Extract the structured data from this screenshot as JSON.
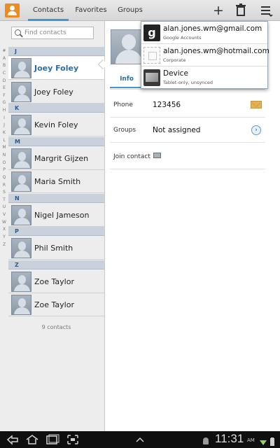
{
  "actionbar": {
    "tabs": [
      {
        "label": "Contacts",
        "active": true
      },
      {
        "label": "Favorites",
        "active": false
      },
      {
        "label": "Groups",
        "active": false
      }
    ],
    "add_icon": "plus-icon",
    "delete_icon": "trash-icon",
    "menu_icon": "overflow-menu-icon"
  },
  "search": {
    "placeholder": "Find contacts"
  },
  "index_letters": [
    "#",
    "A",
    "B",
    "C",
    "D",
    "E",
    "F",
    "G",
    "H",
    "I",
    "J",
    "K",
    "L",
    "M",
    "N",
    "O",
    "P",
    "Q",
    "R",
    "S",
    "T",
    "U",
    "V",
    "W",
    "X",
    "Y",
    "Z"
  ],
  "contacts": [
    {
      "section": "J",
      "entries": [
        "Joey Foley",
        "Joey Foley"
      ]
    },
    {
      "section": "K",
      "entries": [
        "Kevin Foley"
      ]
    },
    {
      "section": "M",
      "entries": [
        "Margrit Gijzen",
        "Maria Smith"
      ]
    },
    {
      "section": "N",
      "entries": [
        "Nigel Jameson"
      ]
    },
    {
      "section": "P",
      "entries": [
        "Phil Smith"
      ]
    },
    {
      "section": "Z",
      "entries": [
        "Zoe Taylor",
        "Zoe Taylor"
      ]
    }
  ],
  "contact_count": "9 contacts",
  "detail": {
    "tab_info": "Info",
    "phone_label": "Phone",
    "phone_value": "123456",
    "groups_label": "Groups",
    "groups_value": "Not assigned",
    "join_label": "Join contact"
  },
  "accounts_dropdown": [
    {
      "name": "alan.jones.wm@gmail.com",
      "type": "Google Accounts",
      "icon": "google-icon"
    },
    {
      "name": "alan.jones.wm@hotmail.com",
      "type": "Corporate",
      "icon": "corporate-icon"
    },
    {
      "name": "Device",
      "type": "Tablet-only, unsynced",
      "icon": "device-icon"
    }
  ],
  "statusbar": {
    "time": "11:31",
    "ampm": "AM"
  },
  "colors": {
    "accent": "#3d9ad1",
    "section_header": "#c9d1db",
    "selected_name": "#2b6ca8"
  }
}
